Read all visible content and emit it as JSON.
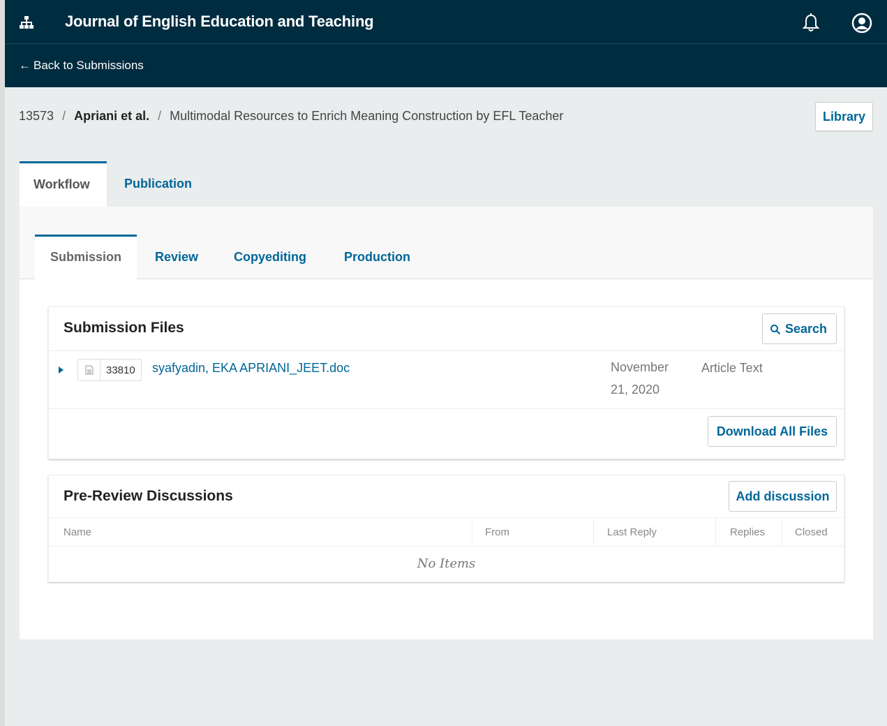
{
  "header": {
    "journal_title": "Journal of English Education and Teaching",
    "back_link": "Back to Submissions",
    "icons": [
      "sitemap-icon",
      "bell-icon",
      "user-circle-icon"
    ],
    "bg_color": "#002c40"
  },
  "breadcrumb": {
    "id": "13573",
    "authors": "Apriani et al.",
    "title": "Multimodal Resources to Enrich Meaning Construction by EFL Teacher"
  },
  "library_button": "Library",
  "main_tabs": [
    {
      "label": "Workflow",
      "active": true
    },
    {
      "label": "Publication",
      "active": false
    }
  ],
  "stage_tabs": [
    {
      "label": "Submission",
      "active": true
    },
    {
      "label": "Review",
      "active": false
    },
    {
      "label": "Copyediting",
      "active": false
    },
    {
      "label": "Production",
      "active": false
    }
  ],
  "submission_files": {
    "title": "Submission Files",
    "search_label": "Search",
    "files": [
      {
        "id": "33810",
        "name": "syafyadin, EKA APRIANI_JEET.doc",
        "date": "November 21, 2020",
        "type": "Article Text"
      }
    ],
    "download_all_label": "Download All Files"
  },
  "discussions": {
    "title": "Pre-Review Discussions",
    "add_label": "Add discussion",
    "columns": [
      "Name",
      "From",
      "Last Reply",
      "Replies",
      "Closed"
    ],
    "empty_text": "No Items"
  },
  "accent_color": "#006798"
}
